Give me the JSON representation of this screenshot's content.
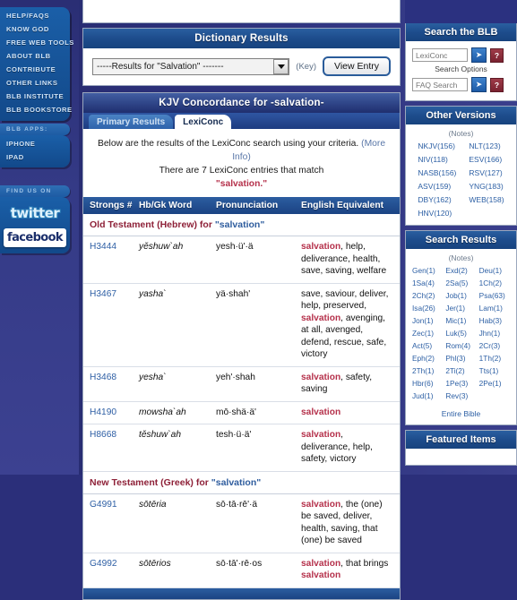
{
  "left_sidebar": {
    "nav_items": [
      {
        "label": "Help/FAQs"
      },
      {
        "label": "Know God"
      },
      {
        "label": "Free Web Tools"
      },
      {
        "label": "About BLB"
      },
      {
        "label": "Contribute"
      },
      {
        "label": "Other Links"
      },
      {
        "label": "BLB Institute"
      },
      {
        "label": "BLB Bookstore"
      }
    ],
    "apps_group": {
      "title": "BLB Apps:",
      "items": [
        {
          "label": "iPhone"
        },
        {
          "label": "iPad"
        }
      ]
    },
    "social_group": {
      "title": "Find Us On",
      "twitter_label": "twitter",
      "facebook_label": "facebook"
    }
  },
  "dictionary": {
    "title": "Dictionary Results",
    "select_value": "-----Results for \"Salvation\" -------",
    "key_label": "(Key)",
    "view_entry_label": "View Entry"
  },
  "concordance": {
    "title": "KJV Concordance for -salvation-",
    "tabs": [
      {
        "label": "Primary Results",
        "active": false
      },
      {
        "label": "LexiConc",
        "active": true
      }
    ],
    "blurb_line1": "Below are the results of the LexiConc search using your criteria.",
    "more_info": "(More Info)",
    "blurb_line2": "There are 7 LexiConc entries that match",
    "blurb_term": "\"salvation.\"",
    "columns": [
      "Strongs #",
      "Hb/Gk Word",
      "Pronunciation",
      "English Equivalent"
    ],
    "sections": [
      {
        "heading_prefix": "Old Testament (Hebrew) for ",
        "heading_term": "\"salvation\"",
        "rows": [
          {
            "strongs": "H3444",
            "word": "yĕshuw`ah",
            "pronunciation": "yesh·ü'·ä",
            "equivalent_html": "<span class=\"hl\">salvation</span>, help, deliverance, health, save, saving, welfare"
          },
          {
            "strongs": "H3467",
            "word": "yasha`",
            "pronunciation": "yä·shah'",
            "equivalent_html": "save, saviour, deliver, help, preserved, <span class=\"hl\">salvation</span>, avenging, at all, avenged, defend, rescue, safe, victory"
          },
          {
            "strongs": "H3468",
            "word": "yesha`",
            "pronunciation": "yeh'·shah",
            "equivalent_html": "<span class=\"hl\">salvation</span>, safety, saving"
          },
          {
            "strongs": "H4190",
            "word": "mowsha`ah",
            "pronunciation": "mō·shä·ä'",
            "equivalent_html": "<span class=\"hl\">salvation</span>"
          },
          {
            "strongs": "H8668",
            "word": "tĕshuw`ah",
            "pronunciation": "tesh·ü·ä'",
            "equivalent_html": "<span class=\"hl\">salvation</span>, deliverance, help, safety, victory"
          }
        ]
      },
      {
        "heading_prefix": "New Testament (Greek) for ",
        "heading_term": "\"salvation\"",
        "rows": [
          {
            "strongs": "G4991",
            "word": "sōtēria",
            "pronunciation": "sō·tā·rē'·ä",
            "equivalent_html": "<span class=\"hl\">salvation</span>, the (one) be saved, deliver, health, saving, that (one) be saved"
          },
          {
            "strongs": "G4992",
            "word": "sōtērios",
            "pronunciation": "sō·tā'·rē·os",
            "equivalent_html": "<span class=\"hl\">salvation</span>, that brings <span class=\"hl\">salvation</span>"
          }
        ]
      }
    ]
  },
  "right_sidebar": {
    "search_panel": {
      "title": "Search the BLB",
      "input1_placeholder": "LexiConc",
      "input2_placeholder": "FAQ Search",
      "search_options_label": "Search Options",
      "go_icon": "arrow-right-icon",
      "help_icon": "question-mark-icon"
    },
    "other_versions": {
      "title": "Other Versions",
      "notes_label": "(Notes)",
      "col1": [
        "NKJV(156)",
        "NIV(118)",
        "NASB(156)",
        "ASV(159)",
        "DBY(162)",
        "HNV(120)"
      ],
      "col2": [
        "NLT(123)",
        "ESV(166)",
        "RSV(127)",
        "YNG(183)",
        "WEB(158)"
      ]
    },
    "search_results": {
      "title": "Search Results",
      "notes_label": "(Notes)",
      "books": [
        "Gen(1)",
        "Exd(2)",
        "Deu(1)",
        "1Sa(4)",
        "2Sa(5)",
        "1Ch(2)",
        "2Ch(2)",
        "Job(1)",
        "Psa(63)",
        "Isa(26)",
        "Jer(1)",
        "Lam(1)",
        "Jon(1)",
        "Mic(1)",
        "Hab(3)",
        "Zec(1)",
        "Luk(5)",
        "Jhn(1)",
        "Act(5)",
        "Rom(4)",
        "2Cr(3)",
        "Eph(2)",
        "Phl(3)",
        "1Th(2)",
        "2Th(1)",
        "2Ti(2)",
        "Tts(1)",
        "Hbr(6)",
        "1Pe(3)",
        "2Pe(1)",
        "Jud(1)",
        "Rev(3)"
      ],
      "entire_bible_label": "Entire Bible"
    },
    "featured": {
      "title": "Featured Items"
    }
  },
  "colors": {
    "header_blue": "#1d4c8c",
    "highlight_red": "#b5314b",
    "link_blue": "#2c5fa4",
    "section_maroon": "#8e2138"
  }
}
